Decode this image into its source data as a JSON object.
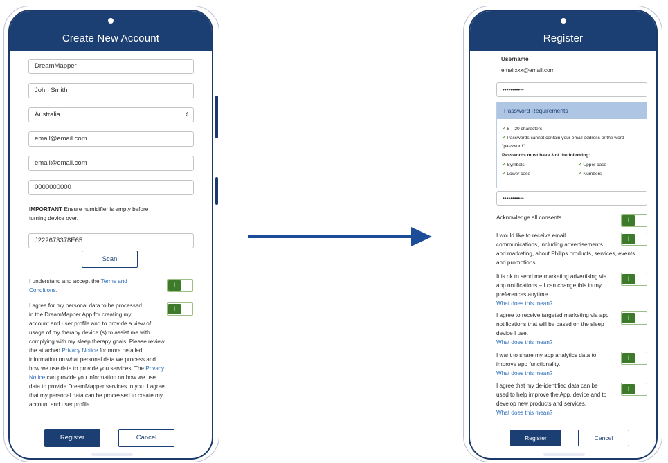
{
  "left_screen": {
    "title": "Create New Account",
    "fields": {
      "app_name": "DreamMapper",
      "full_name": "John Smith",
      "country": "Australia",
      "email": "email@email.com",
      "email_confirm": "email@email.com",
      "phone": "0000000000",
      "serial": "J222673378E65"
    },
    "important_label": "IMPORTANT",
    "important_text": " Ensure humidifier is empty before",
    "important_text_2": "turning device over.",
    "scan_label": "Scan",
    "terms_line1": "I understand and accept the ",
    "terms_link": "Terms and",
    "terms_link2": "Conditions",
    "terms_end": ".",
    "privacy_lines": [
      "I agree for my personal data to be processed",
      "in the DreamMapper App for creating my",
      "account and user profile and to provide a view of",
      "usage of my therapy device (s) to assist me with",
      "complying with my sleep therapy goals. Please review"
    ],
    "privacy_line6_pre": "the attached ",
    "privacy_link1": "Privacy Notice",
    "privacy_line6_post": " for more detailed",
    "privacy_line7": "information on what personal data we process and",
    "privacy_line8_pre": "how we use data to provide you services. The ",
    "privacy_link2a": "Privacy",
    "privacy_link2b": "Notice",
    "privacy_line9_post": " can provide you information on how we use",
    "privacy_lines_end": [
      "data to provide DreamMapper services to you. I agree",
      "that my personal data can be processed to create my",
      "account and user profile."
    ],
    "register_label": "Register",
    "cancel_label": "Cancel"
  },
  "right_screen": {
    "title": "Register",
    "username_label": "Username",
    "username_value": "emailxxx@email.com",
    "password_value": "•••••••••••",
    "password_confirm_value": "•••••••••••",
    "req_title": "Password Requirements",
    "req_items": [
      "8 – 20 characters",
      "Passwords cannot contain your email address or the word"
    ],
    "req_item2_cont": "\"password\"",
    "req_must": "Passwords must have 3 of the following:",
    "req_opts": [
      "Symbols",
      "Upper case",
      "Lower case",
      "Numbers"
    ],
    "check_mark": "✔",
    "consent_all": "Acknowledge all consents",
    "consent1": [
      "I would like to receive email",
      "communications, including advertisements",
      "and marketing, about Philips products, services, events",
      "and promotions."
    ],
    "consent2": [
      "It is ok to send me marketing advertising via",
      "app notifications – I can change this in my",
      "preferences anytime."
    ],
    "consent3": [
      "I agree to receive targeted marketing via app",
      "notifications that will be based on the sleep",
      "device I use."
    ],
    "consent4": [
      "I want to share my app analytics data to",
      "improve app functionality."
    ],
    "consent5": [
      "I agree that my de-identified data can be",
      "used to help improve the App, device and to",
      "develop new products and services."
    ],
    "what_link": "What does this mean?",
    "register_label": "Register",
    "cancel_label": "Cancel"
  },
  "toggle_glyph": "I",
  "select_glyph": "⇕"
}
